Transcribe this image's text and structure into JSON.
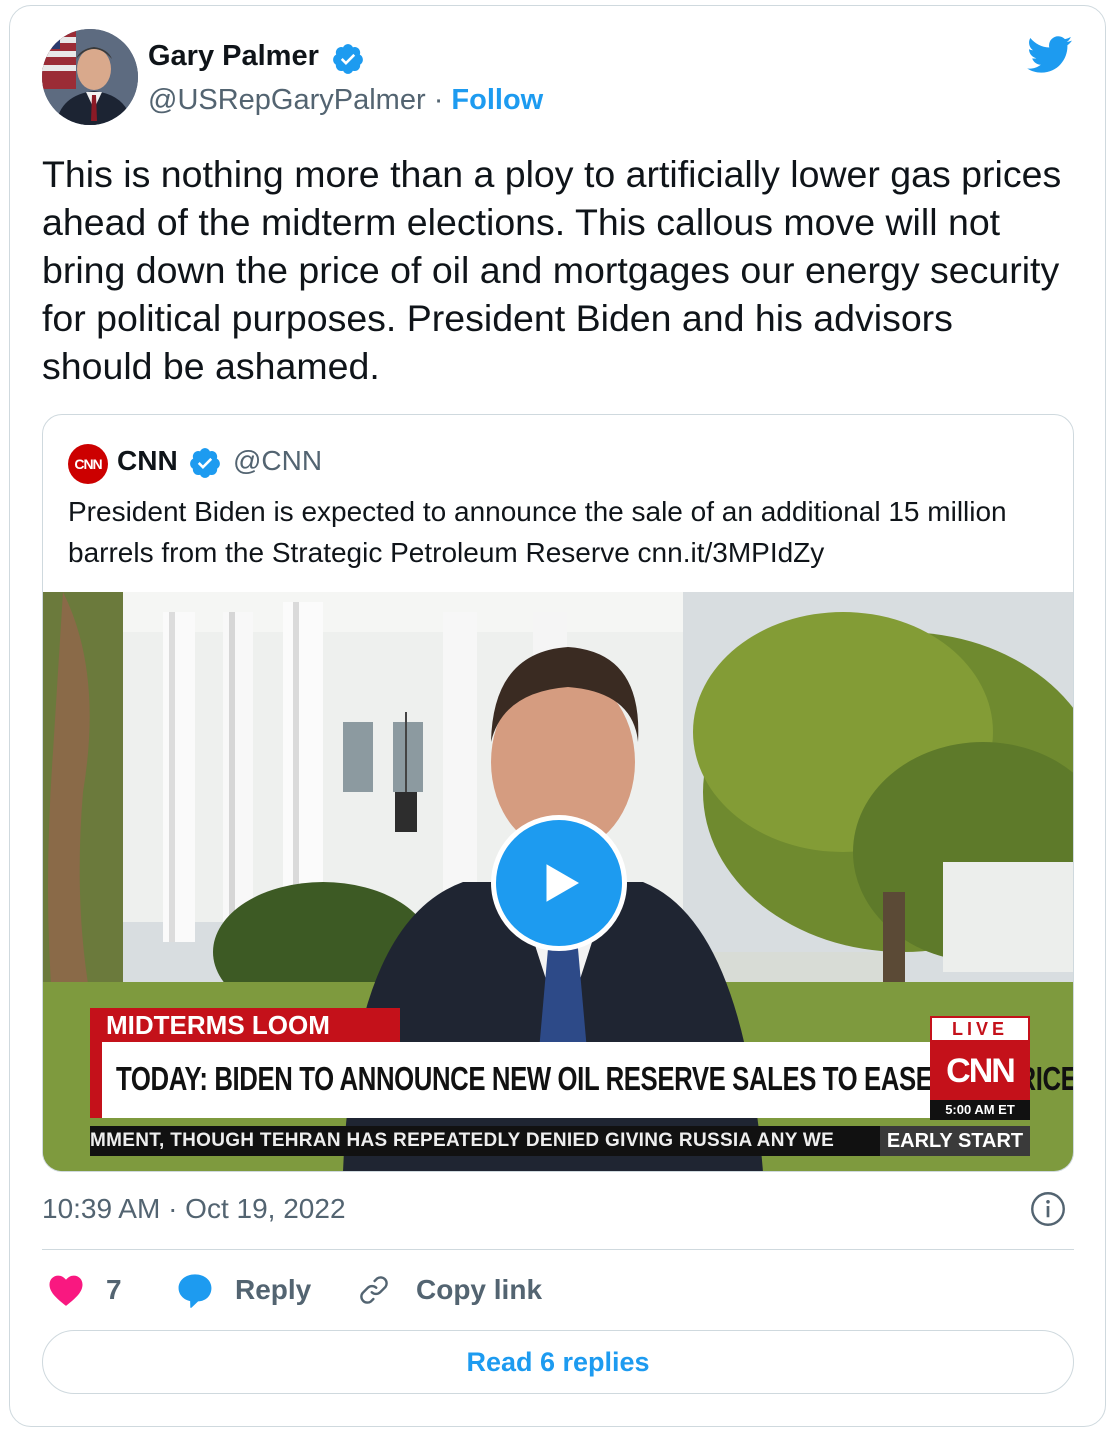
{
  "tweet": {
    "author": {
      "display_name": "Gary Palmer",
      "handle": "@USRepGaryPalmer",
      "separator": "·",
      "follow_label": "Follow",
      "verified": true
    },
    "text": "This is nothing more than a ploy to artificially lower gas prices ahead of the midterm elections. This callous move will not bring down the price of oil and mortgages our energy security for political purposes. President Biden and his advisors should be ashamed.",
    "timestamp": "10:39 AM · Oct 19, 2022",
    "likes": "7",
    "reply_label": "Reply",
    "copy_link_label": "Copy link",
    "read_replies_label": "Read 6 replies"
  },
  "quoted_tweet": {
    "display_name": "CNN",
    "handle": "@CNN",
    "avatar_text": "CNN",
    "verified": true,
    "text": "President Biden is expected to announce the sale of an additional 15 million barrels from the Strategic Petroleum Reserve cnn.it/3MPIdZy",
    "video": {
      "lower_third_tag": "MIDTERMS LOOM",
      "headline": "TODAY: BIDEN TO ANNOUNCE NEW OIL RESERVE SALES TO EASE GAS PRICES",
      "live_label": "LIVE",
      "network_logo": "CNN",
      "time_label": "5:00 AM ET",
      "ticker": "MMENT, THOUGH TEHRAN HAS REPEATEDLY DENIED GIVING RUSSIA ANY WE",
      "show_name": "EARLY START"
    }
  },
  "colors": {
    "twitter_blue": "#1d9bf0",
    "heart_pink": "#f91880",
    "text_primary": "#0f1419",
    "text_secondary": "#536471",
    "border": "#cfd9de",
    "cnn_red": "#c4111a"
  },
  "icons": {
    "brand": "twitter-bird-icon",
    "verified": "verified-badge-icon",
    "info": "info-icon",
    "like": "heart-icon",
    "reply": "speech-bubble-icon",
    "copy_link": "link-icon",
    "play": "play-icon"
  }
}
